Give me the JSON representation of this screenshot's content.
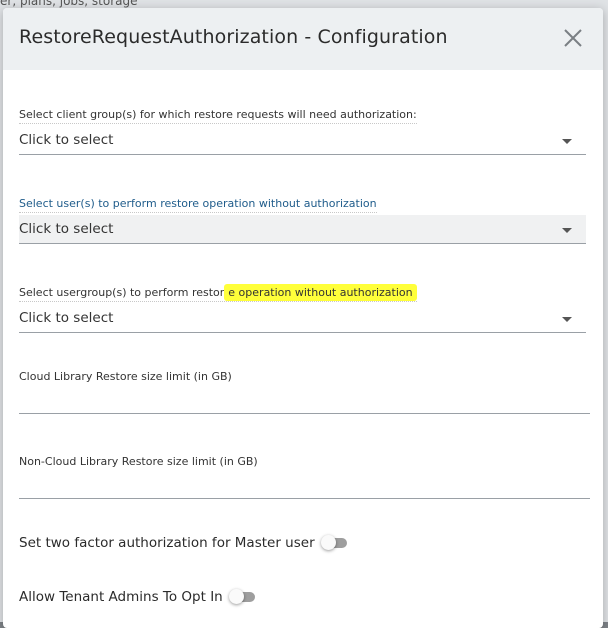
{
  "background": {
    "top_text": "er, plans, jobs, storage"
  },
  "dialog": {
    "title": "RestoreRequestAuthorization - Configuration",
    "fields": [
      {
        "label": "Select client group(s) for which restore requests will need authorization:",
        "value": "Click to select"
      },
      {
        "label": "Select user(s) to perform restore operation without authorization",
        "value": "Click to select"
      },
      {
        "label_plain": "Select usergroup(s) to perform restor",
        "label_highlight": "e operation without authorization",
        "value": "Click to select"
      }
    ],
    "cloud_limit": {
      "label": "Cloud Library Restore size limit (in GB)",
      "value": ""
    },
    "noncloud_limit": {
      "label": "Non-Cloud Library Restore size limit (in GB)",
      "value": ""
    },
    "two_factor": {
      "label": "Set two factor authorization for Master user",
      "enabled": false
    },
    "tenant_admins": {
      "label": "Allow Tenant Admins To Opt In",
      "enabled": false
    }
  },
  "colors": {
    "highlight": "#ffff3a",
    "active_label": "#1f5c8b",
    "header_bg": "#edf0f2"
  }
}
